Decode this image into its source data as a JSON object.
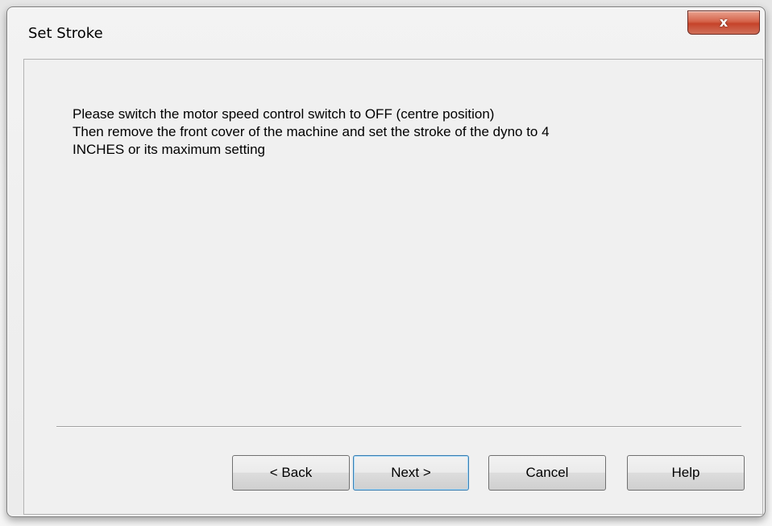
{
  "window": {
    "title": "Set Stroke",
    "close_symbol": "x"
  },
  "message": {
    "lines": [
      "Please switch the motor speed control switch to OFF (centre position)",
      "Then remove the front cover of the machine and set the stroke of the dyno to 4",
      "INCHES or its maximum setting"
    ]
  },
  "buttons": {
    "back": "< Back",
    "next": "Next >",
    "cancel": "Cancel",
    "help": "Help"
  },
  "icons": {
    "close": "close-icon"
  },
  "colors": {
    "close_button": "#c6432a",
    "dialog_background": "#f0f0f0",
    "default_button_border": "#3c7fb1"
  }
}
